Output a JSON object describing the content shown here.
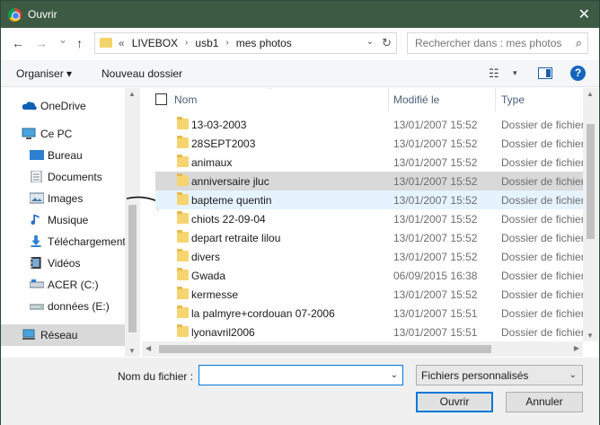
{
  "titlebar": {
    "title": "Ouvrir",
    "close": "✕"
  },
  "nav": {
    "back": "←",
    "forward": "→",
    "recent": "⌄",
    "up": "↑"
  },
  "address": {
    "overflow": "«",
    "crumbs": [
      "LIVEBOX",
      "usb1",
      "mes photos"
    ],
    "separator": "›",
    "refresh": "↻",
    "dropdown": "⌄"
  },
  "search": {
    "placeholder": "Rechercher dans : mes photos",
    "icon": "⌕"
  },
  "toolbar": {
    "organize": "Organiser ▾",
    "new_folder": "Nouveau dossier",
    "view_icon": "☷",
    "view_dd": "▾",
    "help": "?"
  },
  "sidebar": {
    "items": [
      {
        "label": "OneDrive",
        "icon": "onedrive-icon"
      },
      {
        "label": "Ce PC",
        "icon": "pc-icon"
      },
      {
        "label": "Bureau",
        "icon": "desktop-icon"
      },
      {
        "label": "Documents",
        "icon": "documents-icon"
      },
      {
        "label": "Images",
        "icon": "images-icon"
      },
      {
        "label": "Musique",
        "icon": "music-icon"
      },
      {
        "label": "Téléchargement",
        "icon": "download-icon"
      },
      {
        "label": "Vidéos",
        "icon": "video-icon"
      },
      {
        "label": "ACER (C:)",
        "icon": "drive-icon"
      },
      {
        "label": "données (E:)",
        "icon": "drive-icon"
      },
      {
        "label": "Réseau",
        "icon": "network-icon"
      }
    ],
    "selected": "Réseau"
  },
  "columns": {
    "name": "Nom",
    "modified": "Modifié le",
    "type": "Type"
  },
  "files": [
    {
      "name": "13-03-2003",
      "date": "13/01/2007 15:52",
      "type": "Dossier de fichiers"
    },
    {
      "name": "28SEPT2003",
      "date": "13/01/2007 15:52",
      "type": "Dossier de fichiers"
    },
    {
      "name": "animaux",
      "date": "13/01/2007 15:52",
      "type": "Dossier de fichiers"
    },
    {
      "name": "anniversaire jluc",
      "date": "13/01/2007 15:52",
      "type": "Dossier de fichiers"
    },
    {
      "name": "bapteme quentin",
      "date": "13/01/2007 15:52",
      "type": "Dossier de fichiers"
    },
    {
      "name": "chiots 22-09-04",
      "date": "13/01/2007 15:52",
      "type": "Dossier de fichiers"
    },
    {
      "name": "depart retraite lilou",
      "date": "13/01/2007 15:52",
      "type": "Dossier de fichiers"
    },
    {
      "name": "divers",
      "date": "13/01/2007 15:52",
      "type": "Dossier de fichiers"
    },
    {
      "name": "Gwada",
      "date": "06/09/2015 16:38",
      "type": "Dossier de fichiers"
    },
    {
      "name": "kermesse",
      "date": "13/01/2007 15:52",
      "type": "Dossier de fichiers"
    },
    {
      "name": "la palmyre+cordouan 07-2006",
      "date": "13/01/2007 15:51",
      "type": "Dossier de fichiers"
    },
    {
      "name": "lyonavril2006",
      "date": "13/01/2007 15:51",
      "type": "Dossier de fichiers"
    }
  ],
  "selected_file": "anniversaire jluc",
  "hover_file": "bapteme quentin",
  "footer": {
    "filename_label": "Nom du fichier :",
    "filename_value": "",
    "filter": "Fichiers personnalisés",
    "open": "Ouvrir",
    "cancel": "Annuler"
  },
  "colors": {
    "titlebar": "#3d5a45",
    "accent": "#0078d7",
    "folder": "#f6d470"
  }
}
